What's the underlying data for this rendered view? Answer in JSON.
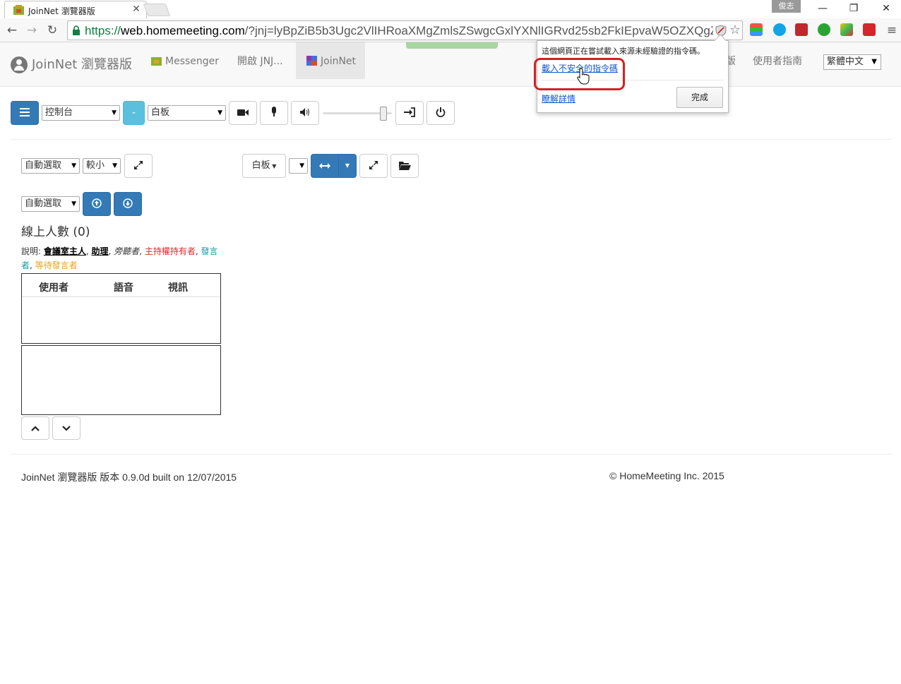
{
  "browser": {
    "tab_title": "JoinNet 瀏覽器版",
    "user_badge": "俊志",
    "url_scheme": "https://",
    "url_host": "web.homemeeting.com",
    "url_rest": "/?jnj=lyBpZiB5b3Ugc2VlIHRoaXMgZmlsZSwgcGxlYXNlIGRvd25sb2FkIEpvaW5OZXQgZı"
  },
  "popup": {
    "message": "這個網頁正在嘗試載入來源未經驗證的指令碼。",
    "load_unsafe_link": "載入不安全的指令碼",
    "learn_more_link": "瞭解詳情",
    "done_button": "完成"
  },
  "navbar": {
    "brand": "JoinNet 瀏覽器版",
    "items": [
      {
        "label": "Messenger"
      },
      {
        "label": "開啟 JNJ..."
      },
      {
        "label": "JoinNet"
      }
    ],
    "hidden_tail": "版",
    "user_guide": "使用者指南",
    "language": "繁體中文"
  },
  "controls": {
    "console_select": "控制台",
    "minus_label": "-",
    "whiteboard_select": "白板",
    "volume_level": 0.92
  },
  "panel": {
    "auto_select_1": "自動選取",
    "size_select": "較小",
    "whiteboard_dropdown": "白板",
    "auto_select_2": "自動選取",
    "online_count": "線上人數 (0)",
    "legend": {
      "prefix": "說明: ",
      "owner": "會議室主人",
      "assistant": "助理",
      "silent": "旁聽者",
      "host": "主持權持有者",
      "speaker": "發言者",
      "waiting": "等待發言者",
      "sep": ", "
    },
    "table_headers": {
      "user": "使用者",
      "audio": "語音",
      "video": "視訊"
    }
  },
  "footer": {
    "version": "JoinNet 瀏覽器版 版本 0.9.0d built on 12/07/2015",
    "copyright": "© HomeMeeting Inc. 2015"
  },
  "colors": {
    "primary": "#337ab7",
    "info": "#5bc0de",
    "highlight": "#d41f26",
    "link": "#1155cc"
  }
}
